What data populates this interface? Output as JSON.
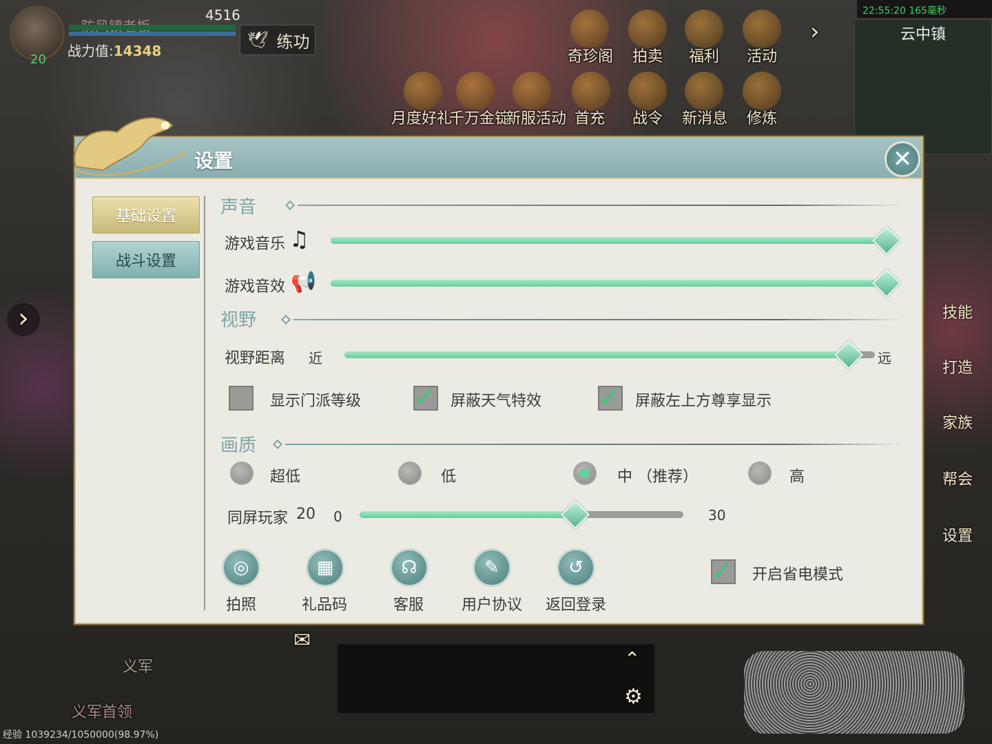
{
  "hud": {
    "player_name": "防风镇老板",
    "hp_value": "4516",
    "level": "20",
    "power_label": "战力值:",
    "power_value": "14348",
    "practice_label": "练功",
    "top_icons": [
      "奇珍阁",
      "拍卖",
      "福利",
      "活动"
    ],
    "second_icons": [
      "月度好礼",
      "千万金锭",
      "新服活动",
      "首充",
      "战令",
      "新消息",
      "修炼"
    ],
    "status": "22:55:20 165毫秒",
    "map_title": "云中镇",
    "side_icons": [
      "技能",
      "打造",
      "家族",
      "帮会",
      "设置"
    ],
    "bottom_label_1": "义军",
    "bottom_label_2": "义军首领",
    "exp_text": "经验 1039234/1050000(98.97%)"
  },
  "dialog": {
    "title": "设置",
    "tabs": [
      {
        "label": "基础设置",
        "active": true
      },
      {
        "label": "战斗设置",
        "active": false
      }
    ],
    "sound": {
      "section": "声音",
      "music_label": "游戏音乐",
      "music_icon": "music-note-icon",
      "music_level": 1.0,
      "effects_label": "游戏音效",
      "effects_icon": "speaker-icon",
      "effects_level": 1.0
    },
    "view": {
      "section": "视野",
      "distance_label": "视野距离",
      "near": "近",
      "far": "远",
      "distance_level": 0.95
    },
    "checks": [
      {
        "label": "显示门派等级",
        "checked": false
      },
      {
        "label": "屏蔽天气特效",
        "checked": true
      },
      {
        "label": "屏蔽左上方尊享显示",
        "checked": true
      }
    ],
    "quality": {
      "section": "画质",
      "options": [
        {
          "label": "超低",
          "selected": false
        },
        {
          "label": "低",
          "selected": false
        },
        {
          "label": "中 （推荐）",
          "selected": true
        },
        {
          "label": "高",
          "selected": false
        }
      ],
      "players_label": "同屏玩家",
      "players_value": "20",
      "players_min": "0",
      "players_max": "30",
      "players_level": 0.667
    },
    "buttons": [
      {
        "label": "拍照",
        "icon": "camera-icon"
      },
      {
        "label": "礼品码",
        "icon": "gift-icon"
      },
      {
        "label": "客服",
        "icon": "headset-icon"
      },
      {
        "label": "用户协议",
        "icon": "scroll-icon"
      },
      {
        "label": "返回登录",
        "icon": "return-icon"
      }
    ],
    "power_save": {
      "label": "开启省电模式",
      "checked": true
    },
    "colors": {
      "accent": "#5fcf9a",
      "header": "#8aaeb0",
      "gold": "#c9b879"
    }
  }
}
